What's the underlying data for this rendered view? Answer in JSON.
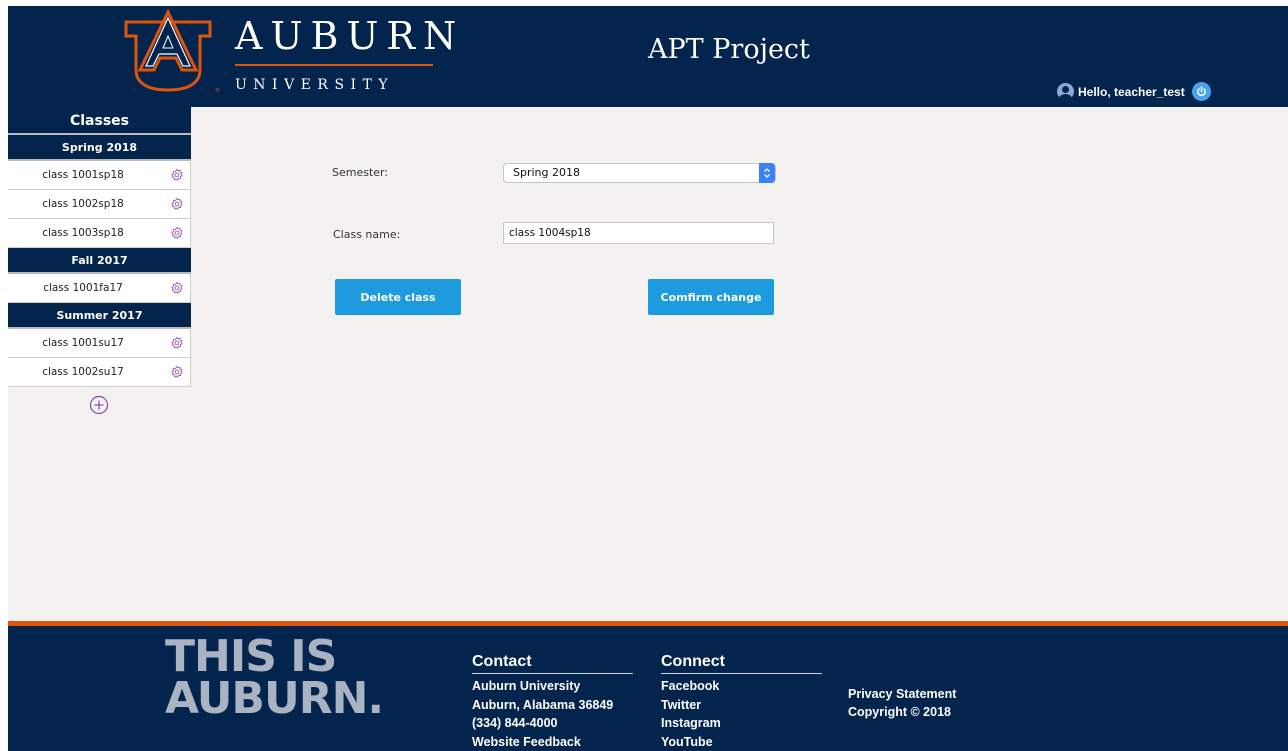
{
  "header": {
    "logo_text": "AUBURN",
    "logo_subtext": "UNIVERSITY",
    "title": "APT Project",
    "greeting": "Hello, teacher_test",
    "brand_navy": "#03244d",
    "brand_orange": "#dd550c"
  },
  "sidebar": {
    "title": "Classes",
    "groups": [
      {
        "label": "Spring 2018",
        "items": [
          "class 1001sp18",
          "class 1002sp18",
          "class 1003sp18"
        ]
      },
      {
        "label": "Fall 2017",
        "items": [
          "class 1001fa17"
        ]
      },
      {
        "label": "Summer 2017",
        "items": [
          "class 1001su17",
          "class 1002su17"
        ]
      }
    ],
    "item_icon": "gear-icon",
    "add_icon": "plus-circle-icon"
  },
  "form": {
    "semester_label": "Semester:",
    "semester_value": "Spring 2018",
    "classname_label": "Class name:",
    "classname_value": "class 1004sp18",
    "delete_label": "Delete class",
    "confirm_label": "Comfirm change",
    "button_color": "#1d9bde"
  },
  "footer": {
    "tagline_line1": "THIS IS",
    "tagline_line2": "AUBURN.",
    "contact": {
      "heading": "Contact",
      "lines": [
        "Auburn University",
        "Auburn, Alabama 36849",
        "(334) 844-4000",
        "Website Feedback"
      ]
    },
    "connect": {
      "heading": "Connect",
      "lines": [
        "Facebook",
        "Twitter",
        "Instagram",
        "YouTube"
      ]
    },
    "privacy": "Privacy Statement",
    "copyright": "Copyright © 2018"
  }
}
